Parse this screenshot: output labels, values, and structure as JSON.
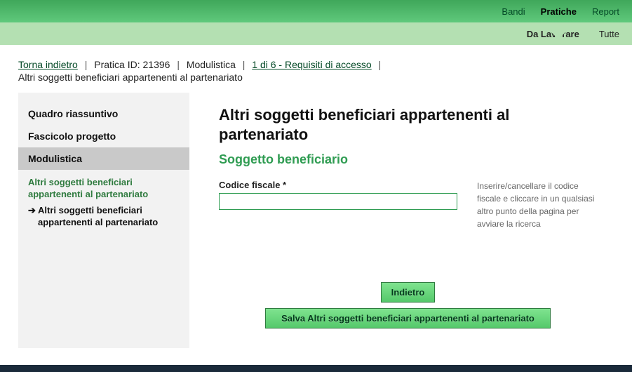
{
  "top_nav": {
    "items": [
      "Bandi",
      "Pratiche",
      "Report"
    ],
    "active": 1
  },
  "sub_nav": {
    "items": [
      "Da Lavorare",
      "Tutte"
    ],
    "active": 0
  },
  "breadcrumb": {
    "back": "Torna indietro",
    "pratica": "Pratica ID: 21396",
    "modulistica": "Modulistica",
    "step_link": "1 di 6 - Requisiti di accesso"
  },
  "subtitle": "Altri soggetti beneficiari appartenenti al partenariato",
  "sidebar": {
    "tabs": [
      "Quadro riassuntivo",
      "Fascicolo progetto",
      "Modulistica"
    ],
    "active": 2,
    "section": "Altri soggetti beneficiari appartenenti al partenariato",
    "sub": "Altri soggetti beneficiari appartenenti al partenariato"
  },
  "main": {
    "title": "Altri soggetti beneficiari appartenenti al partenariato",
    "section": "Soggetto beneficiario",
    "field_label": "Codice fiscale *",
    "field_value": "",
    "hint": "Inserire/cancellare il codice fiscale e cliccare in un qualsiasi altro punto della pagina per avviare la ricerca"
  },
  "buttons": {
    "back": "Indietro",
    "save": "Salva Altri soggetti beneficiari appartenenti al partenariato"
  }
}
